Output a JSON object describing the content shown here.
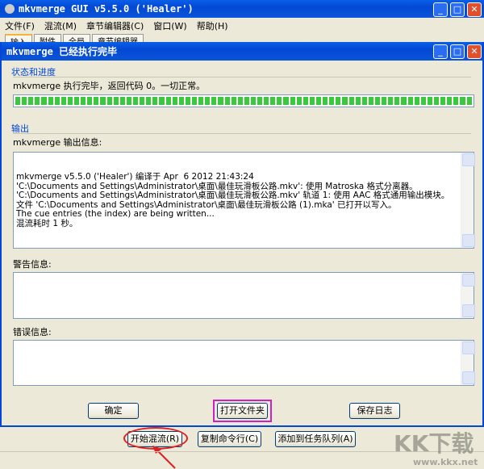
{
  "main_window": {
    "title": "mkvmerge GUI v5.5.0 ('Healer')",
    "menu": [
      "文件(F)",
      "混流(M)",
      "章节编辑器(C)",
      "窗口(W)",
      "帮助(H)"
    ],
    "tabs": [
      "输入",
      "附件",
      "全局",
      "章节编辑器"
    ],
    "buttons": {
      "start": "开始混流(R)",
      "copy_cmd": "复制命令行(C)",
      "add_queue": "添加到任务队列(A)"
    }
  },
  "dialog": {
    "title": "mkvmerge 已经执行完毕",
    "status_group": "状态和进度",
    "status_text": "mkvmerge 执行完毕，返回代码 0。一切正常。",
    "progress_percent": 100,
    "output_group": "输出",
    "output_label": "mkvmerge 输出信息:",
    "output_lines": [
      "mkvmerge v5.5.0 ('Healer') 编译于 Apr  6 2012 21:43:24",
      "'C:\\Documents and Settings\\Administrator\\桌面\\最佳玩滑板公路.mkv': 使用 Matroska 格式分离器。",
      "'C:\\Documents and Settings\\Administrator\\桌面\\最佳玩滑板公路.mkv' 轨道 1: 使用 AAC 格式通用输出模块。",
      "文件 'C:\\Documents and Settings\\Administrator\\桌面\\最佳玩滑板公路 (1).mka' 已打开以写入。",
      "The cue entries (the index) are being written...",
      "混流耗时 1 秒。"
    ],
    "warning_label": "警告信息:",
    "warning_text": "",
    "error_label": "错误信息:",
    "error_text": "",
    "buttons": {
      "ok": "确定",
      "open_folder": "打开文件夹",
      "save_log": "保存日志"
    }
  },
  "watermark": {
    "logo": "KK下载",
    "url": "www.kkx.net"
  },
  "colors": {
    "titlebar": "#0348d4",
    "progress": "#3cc83c",
    "highlight": "#d020c0",
    "annotation": "#e02020"
  }
}
